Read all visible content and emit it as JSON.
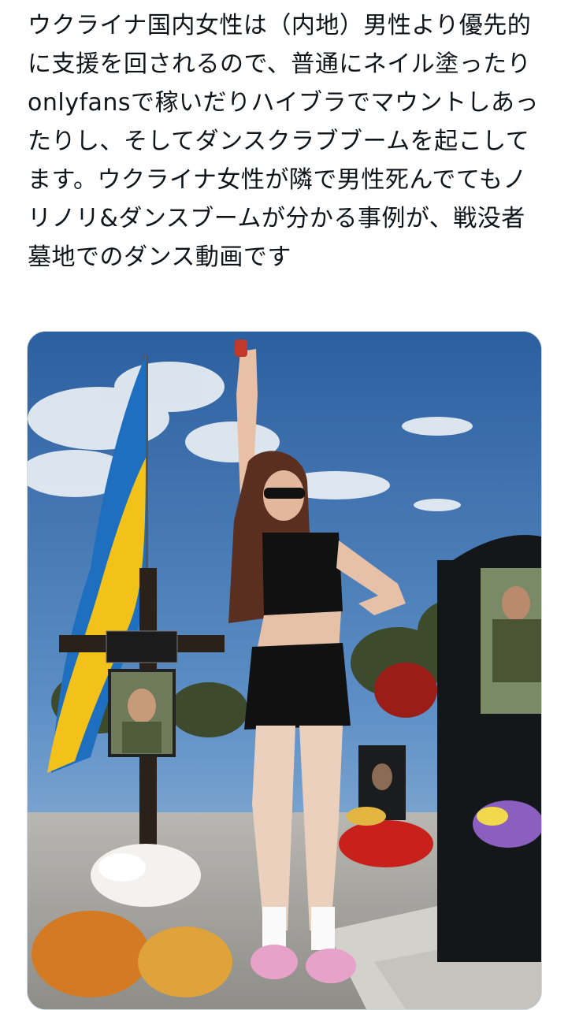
{
  "tweet": {
    "text": "ウクライナ国内女性は（内地）男性より優先的に支援を回されるので、普通にネイル塗ったりonlyfansで稼いだりハイブラでマウントしあったりし、そしてダンスクラブブームを起こしてます。ウクライナ女性が隣で男性死んでてもノリノリ&ダンスブームが分かる事例が、戦没者墓地でのダンス動画です"
  },
  "media": {
    "kind": "photo",
    "colors": {
      "sky_top": "#2f62a3",
      "sky_bottom": "#7fa8d4",
      "flag_blue": "#1f6fc0",
      "flag_yellow": "#f2c21b",
      "headstone": "#14171a",
      "flowers_red": "#c8201a",
      "ground": "#9a9a96"
    }
  }
}
